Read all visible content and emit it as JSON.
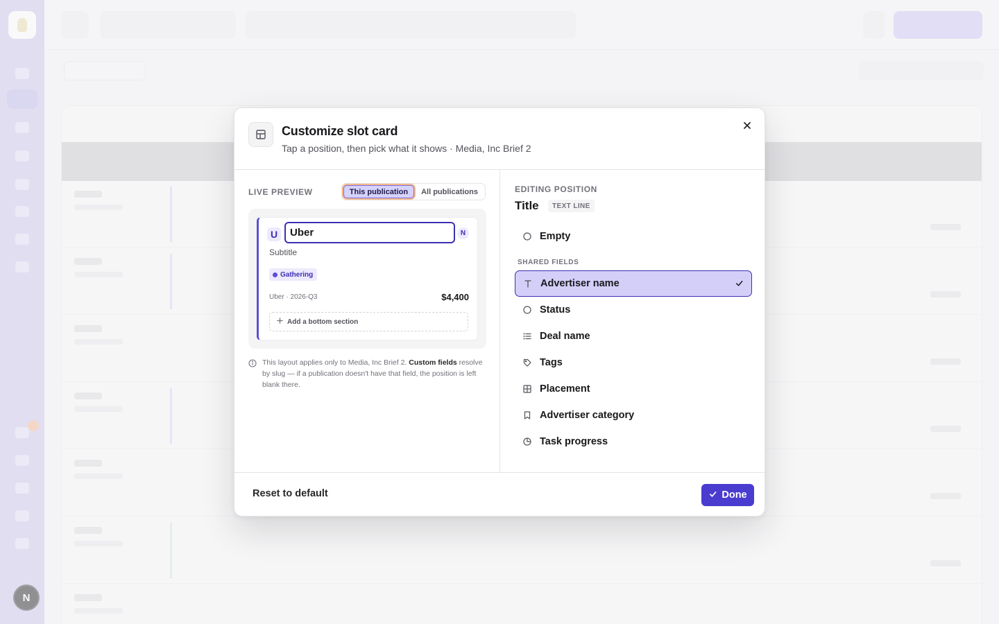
{
  "modal": {
    "title": "Customize slot card",
    "subtitle": "Tap a position, then pick what it shows · Media, Inc Brief 2"
  },
  "preview": {
    "label": "LIVE PREVIEW",
    "scope_options": [
      {
        "label": "This publication",
        "selected": true
      },
      {
        "label": "All publications",
        "selected": false
      }
    ],
    "card": {
      "initial": "U",
      "title_value": "Uber",
      "corner_badge": "N",
      "subtitle": "Subtitle",
      "status_badge": "Gathering",
      "meta": "Uber · 2026-Q3",
      "price": "$4,400",
      "add_section": "Add a bottom section"
    },
    "note_prefix": "This layout applies only to Media, Inc Brief 2. ",
    "note_bold": "Custom fields",
    "note_suffix": " resolve by slug — if a publication doesn't have that field, the position is left blank there."
  },
  "editor": {
    "label": "EDITING POSITION",
    "position_title": "Title",
    "position_type": "TEXT LINE",
    "empty_option": "Empty",
    "shared_label": "SHARED FIELDS",
    "options": [
      {
        "label": "Advertiser name",
        "icon": "text-icon",
        "selected": true
      },
      {
        "label": "Status",
        "icon": "circle-icon",
        "selected": false
      },
      {
        "label": "Deal name",
        "icon": "list-icon",
        "selected": false
      },
      {
        "label": "Tags",
        "icon": "tag-icon",
        "selected": false
      },
      {
        "label": "Placement",
        "icon": "grid-icon",
        "selected": false
      },
      {
        "label": "Advertiser category",
        "icon": "bookmark-icon",
        "selected": false
      },
      {
        "label": "Task progress",
        "icon": "pie-icon",
        "selected": false
      }
    ]
  },
  "footer": {
    "reset_label": "Reset to default",
    "done_label": "Done"
  },
  "colors": {
    "accent": "#4a3ccf",
    "selected_bg": "#d4cff9"
  }
}
